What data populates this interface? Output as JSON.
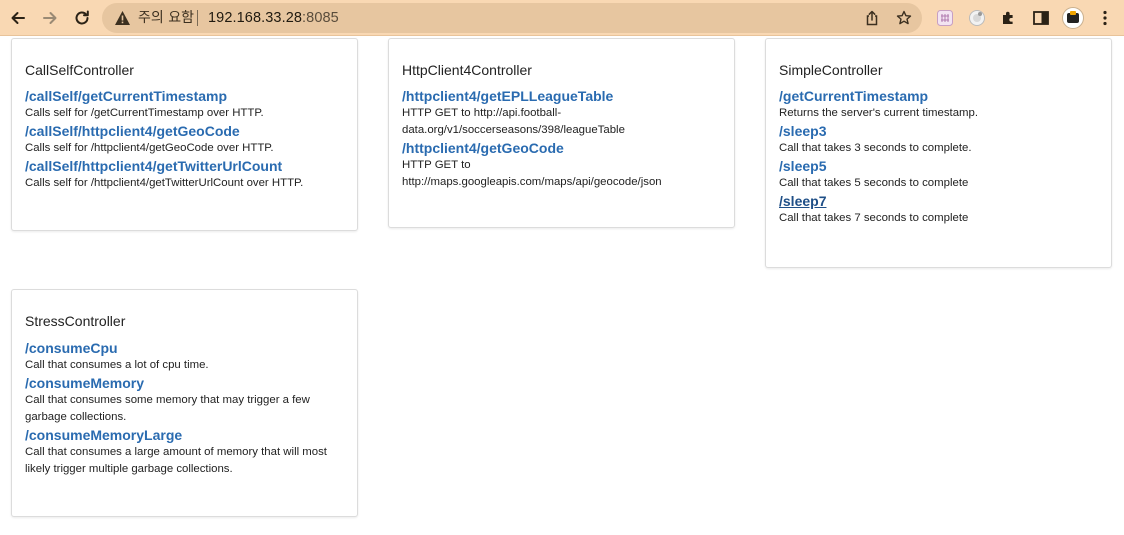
{
  "browser": {
    "security_status": "주의 요함",
    "url_host": "192.168.33.28",
    "url_port": ":8085",
    "icons": {
      "back": "back-arrow-icon",
      "forward": "forward-arrow-icon",
      "reload": "reload-icon",
      "warning": "warning-triangle-icon",
      "share": "share-icon",
      "bookmark": "star-icon",
      "extensions": "puzzle-icon",
      "side_panel": "side-panel-icon",
      "menu": "kebab-menu-icon"
    },
    "colors": {
      "toolbar": "#f9d8b3",
      "omnibox": "#e7c6a0"
    }
  },
  "page": {
    "link_color": "#2a6bb0",
    "controllers": [
      {
        "title": "CallSelfController",
        "endpoints": [
          {
            "path": "/callSelf/getCurrentTimestamp",
            "desc": "Calls self for /getCurrentTimestamp over HTTP."
          },
          {
            "path": "/callSelf/httpclient4/getGeoCode",
            "desc": "Calls self for /httpclient4/getGeoCode over HTTP."
          },
          {
            "path": "/callSelf/httpclient4/getTwitterUrlCount",
            "desc": "Calls self for /httpclient4/getTwitterUrlCount over HTTP."
          }
        ]
      },
      {
        "title": "HttpClient4Controller",
        "endpoints": [
          {
            "path": "/httpclient4/getEPLLeagueTable",
            "desc": "HTTP GET to http://api.football-data.org/v1/soccerseasons/398/leagueTable"
          },
          {
            "path": "/httpclient4/getGeoCode",
            "desc": "HTTP GET to http://maps.googleapis.com/maps/api/geocode/json"
          }
        ]
      },
      {
        "title": "SimpleController",
        "endpoints": [
          {
            "path": "/getCurrentTimestamp",
            "desc": "Returns the server's current timestamp."
          },
          {
            "path": "/sleep3",
            "desc": "Call that takes 3 seconds to complete."
          },
          {
            "path": "/sleep5",
            "desc": "Call that takes 5 seconds to complete"
          },
          {
            "path": "/sleep7",
            "desc": "Call that takes 7 seconds to complete",
            "visited": true
          }
        ]
      },
      {
        "title": "StressController",
        "endpoints": [
          {
            "path": "/consumeCpu",
            "desc": "Call that consumes a lot of cpu time."
          },
          {
            "path": "/consumeMemory",
            "desc": "Call that consumes some memory that may trigger a few garbage collections."
          },
          {
            "path": "/consumeMemoryLarge",
            "desc": "Call that consumes a large amount of memory that will most likely trigger multiple garbage collections."
          }
        ]
      }
    ]
  }
}
